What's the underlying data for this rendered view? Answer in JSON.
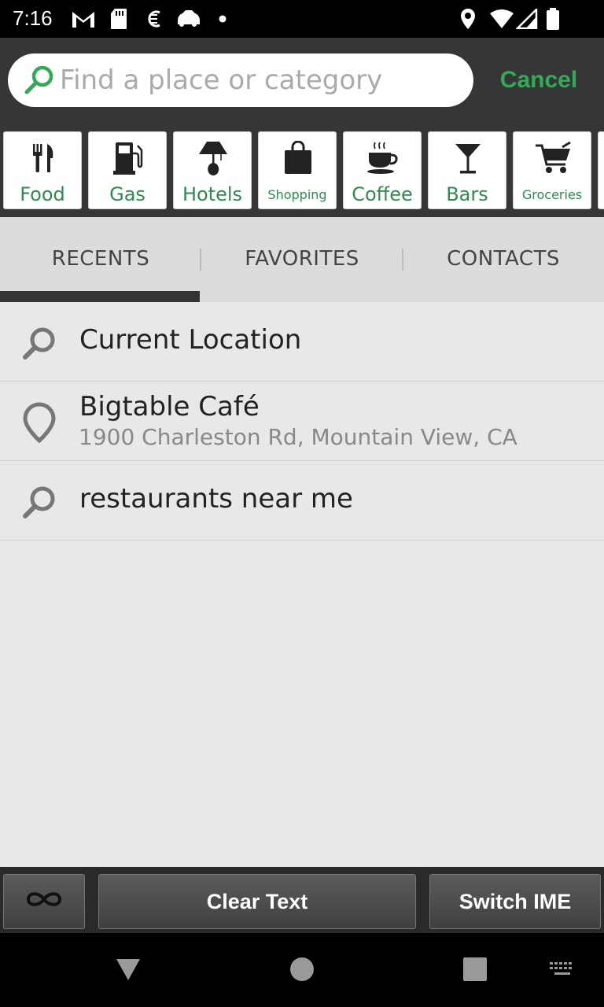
{
  "status_bar": {
    "time": "7:16",
    "icons": [
      "gmail-icon",
      "sd-card-icon",
      "sync-icon",
      "car-icon",
      "dot-icon",
      "location-icon",
      "wifi-icon",
      "signal-icon",
      "battery-icon"
    ]
  },
  "search": {
    "placeholder": "Find a place or category",
    "value": "",
    "cancel_label": "Cancel",
    "accent_color": "#33aa55"
  },
  "categories": [
    {
      "label": "Food",
      "icon": "fork-knife-icon"
    },
    {
      "label": "Gas",
      "icon": "gas-pump-icon"
    },
    {
      "label": "Hotels",
      "icon": "lamp-icon"
    },
    {
      "label": "Shopping",
      "icon": "shopping-bag-icon"
    },
    {
      "label": "Coffee",
      "icon": "coffee-cup-icon"
    },
    {
      "label": "Bars",
      "icon": "martini-icon"
    },
    {
      "label": "Groceries",
      "icon": "cart-icon"
    }
  ],
  "tabs": [
    {
      "label": "RECENTS",
      "active": true
    },
    {
      "label": "FAVORITES",
      "active": false
    },
    {
      "label": "CONTACTS",
      "active": false
    }
  ],
  "recents": [
    {
      "title": "Current Location",
      "subtitle": "",
      "icon": "search-icon"
    },
    {
      "title": "Bigtable Café",
      "subtitle": "1900 Charleston Rd, Mountain View, CA",
      "icon": "place-pin-icon"
    },
    {
      "title": "restaurants near me",
      "subtitle": "",
      "icon": "search-icon"
    }
  ],
  "toolbar": {
    "infinity_icon": "infinity-icon",
    "clear_text_label": "Clear Text",
    "switch_ime_label": "Switch IME"
  },
  "nav_bar": {
    "icons": [
      "back-icon",
      "home-icon",
      "recents-icon",
      "keyboard-icon"
    ]
  }
}
